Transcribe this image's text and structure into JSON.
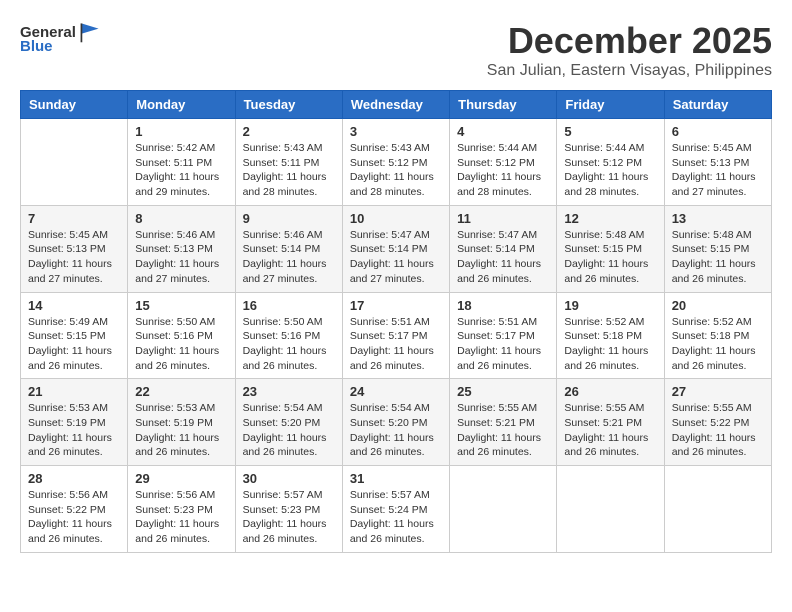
{
  "logo": {
    "general": "General",
    "blue": "Blue"
  },
  "title": "December 2025",
  "subtitle": "San Julian, Eastern Visayas, Philippines",
  "weekdays": [
    "Sunday",
    "Monday",
    "Tuesday",
    "Wednesday",
    "Thursday",
    "Friday",
    "Saturday"
  ],
  "weeks": [
    [
      {
        "day": "",
        "info": ""
      },
      {
        "day": "1",
        "info": "Sunrise: 5:42 AM\nSunset: 5:11 PM\nDaylight: 11 hours\nand 29 minutes."
      },
      {
        "day": "2",
        "info": "Sunrise: 5:43 AM\nSunset: 5:11 PM\nDaylight: 11 hours\nand 28 minutes."
      },
      {
        "day": "3",
        "info": "Sunrise: 5:43 AM\nSunset: 5:12 PM\nDaylight: 11 hours\nand 28 minutes."
      },
      {
        "day": "4",
        "info": "Sunrise: 5:44 AM\nSunset: 5:12 PM\nDaylight: 11 hours\nand 28 minutes."
      },
      {
        "day": "5",
        "info": "Sunrise: 5:44 AM\nSunset: 5:12 PM\nDaylight: 11 hours\nand 28 minutes."
      },
      {
        "day": "6",
        "info": "Sunrise: 5:45 AM\nSunset: 5:13 PM\nDaylight: 11 hours\nand 27 minutes."
      }
    ],
    [
      {
        "day": "7",
        "info": "Sunrise: 5:45 AM\nSunset: 5:13 PM\nDaylight: 11 hours\nand 27 minutes."
      },
      {
        "day": "8",
        "info": "Sunrise: 5:46 AM\nSunset: 5:13 PM\nDaylight: 11 hours\nand 27 minutes."
      },
      {
        "day": "9",
        "info": "Sunrise: 5:46 AM\nSunset: 5:14 PM\nDaylight: 11 hours\nand 27 minutes."
      },
      {
        "day": "10",
        "info": "Sunrise: 5:47 AM\nSunset: 5:14 PM\nDaylight: 11 hours\nand 27 minutes."
      },
      {
        "day": "11",
        "info": "Sunrise: 5:47 AM\nSunset: 5:14 PM\nDaylight: 11 hours\nand 26 minutes."
      },
      {
        "day": "12",
        "info": "Sunrise: 5:48 AM\nSunset: 5:15 PM\nDaylight: 11 hours\nand 26 minutes."
      },
      {
        "day": "13",
        "info": "Sunrise: 5:48 AM\nSunset: 5:15 PM\nDaylight: 11 hours\nand 26 minutes."
      }
    ],
    [
      {
        "day": "14",
        "info": "Sunrise: 5:49 AM\nSunset: 5:15 PM\nDaylight: 11 hours\nand 26 minutes."
      },
      {
        "day": "15",
        "info": "Sunrise: 5:50 AM\nSunset: 5:16 PM\nDaylight: 11 hours\nand 26 minutes."
      },
      {
        "day": "16",
        "info": "Sunrise: 5:50 AM\nSunset: 5:16 PM\nDaylight: 11 hours\nand 26 minutes."
      },
      {
        "day": "17",
        "info": "Sunrise: 5:51 AM\nSunset: 5:17 PM\nDaylight: 11 hours\nand 26 minutes."
      },
      {
        "day": "18",
        "info": "Sunrise: 5:51 AM\nSunset: 5:17 PM\nDaylight: 11 hours\nand 26 minutes."
      },
      {
        "day": "19",
        "info": "Sunrise: 5:52 AM\nSunset: 5:18 PM\nDaylight: 11 hours\nand 26 minutes."
      },
      {
        "day": "20",
        "info": "Sunrise: 5:52 AM\nSunset: 5:18 PM\nDaylight: 11 hours\nand 26 minutes."
      }
    ],
    [
      {
        "day": "21",
        "info": "Sunrise: 5:53 AM\nSunset: 5:19 PM\nDaylight: 11 hours\nand 26 minutes."
      },
      {
        "day": "22",
        "info": "Sunrise: 5:53 AM\nSunset: 5:19 PM\nDaylight: 11 hours\nand 26 minutes."
      },
      {
        "day": "23",
        "info": "Sunrise: 5:54 AM\nSunset: 5:20 PM\nDaylight: 11 hours\nand 26 minutes."
      },
      {
        "day": "24",
        "info": "Sunrise: 5:54 AM\nSunset: 5:20 PM\nDaylight: 11 hours\nand 26 minutes."
      },
      {
        "day": "25",
        "info": "Sunrise: 5:55 AM\nSunset: 5:21 PM\nDaylight: 11 hours\nand 26 minutes."
      },
      {
        "day": "26",
        "info": "Sunrise: 5:55 AM\nSunset: 5:21 PM\nDaylight: 11 hours\nand 26 minutes."
      },
      {
        "day": "27",
        "info": "Sunrise: 5:55 AM\nSunset: 5:22 PM\nDaylight: 11 hours\nand 26 minutes."
      }
    ],
    [
      {
        "day": "28",
        "info": "Sunrise: 5:56 AM\nSunset: 5:22 PM\nDaylight: 11 hours\nand 26 minutes."
      },
      {
        "day": "29",
        "info": "Sunrise: 5:56 AM\nSunset: 5:23 PM\nDaylight: 11 hours\nand 26 minutes."
      },
      {
        "day": "30",
        "info": "Sunrise: 5:57 AM\nSunset: 5:23 PM\nDaylight: 11 hours\nand 26 minutes."
      },
      {
        "day": "31",
        "info": "Sunrise: 5:57 AM\nSunset: 5:24 PM\nDaylight: 11 hours\nand 26 minutes."
      },
      {
        "day": "",
        "info": ""
      },
      {
        "day": "",
        "info": ""
      },
      {
        "day": "",
        "info": ""
      }
    ]
  ]
}
